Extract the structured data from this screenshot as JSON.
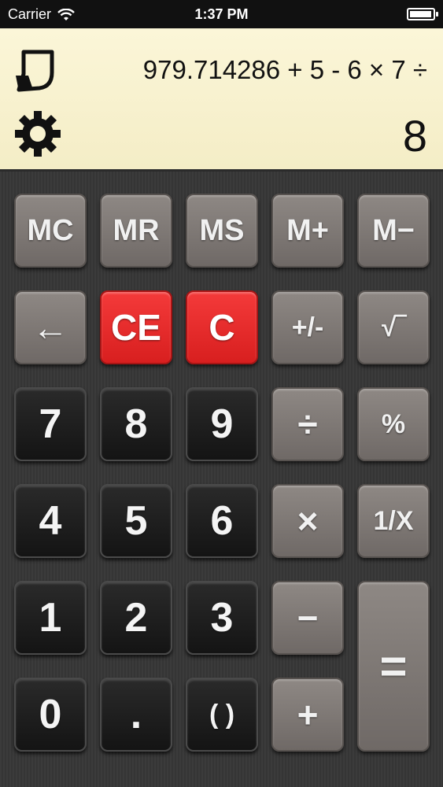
{
  "status_bar": {
    "carrier": "Carrier",
    "time": "1:37 PM",
    "battery_level": 0.95
  },
  "display": {
    "expression": "979.714286 + 5 - 6 × 7 ÷",
    "result": "8",
    "history_icon": "history-icon",
    "settings_icon": "gear-icon"
  },
  "keys": {
    "mc": "MC",
    "mr": "MR",
    "ms": "MS",
    "mplus": "M+",
    "mminus": "M−",
    "backspace": "←",
    "ce": "CE",
    "c": "C",
    "plusminus": "+/-",
    "sqrt": "√‾",
    "d7": "7",
    "d8": "8",
    "d9": "9",
    "divide": "÷",
    "percent": "%",
    "d4": "4",
    "d5": "5",
    "d6": "6",
    "multiply": "×",
    "reciprocal": "1/X",
    "d1": "1",
    "d2": "2",
    "d3": "3",
    "minus": "−",
    "equals": "=",
    "d0": "0",
    "dot": ".",
    "parens": "( )",
    "plus": "+"
  },
  "colors": {
    "display_bg": "#fbf6d8",
    "red_key": "#e52a2a",
    "gray_key": "#7d7774",
    "black_key": "#1c1c1c"
  }
}
